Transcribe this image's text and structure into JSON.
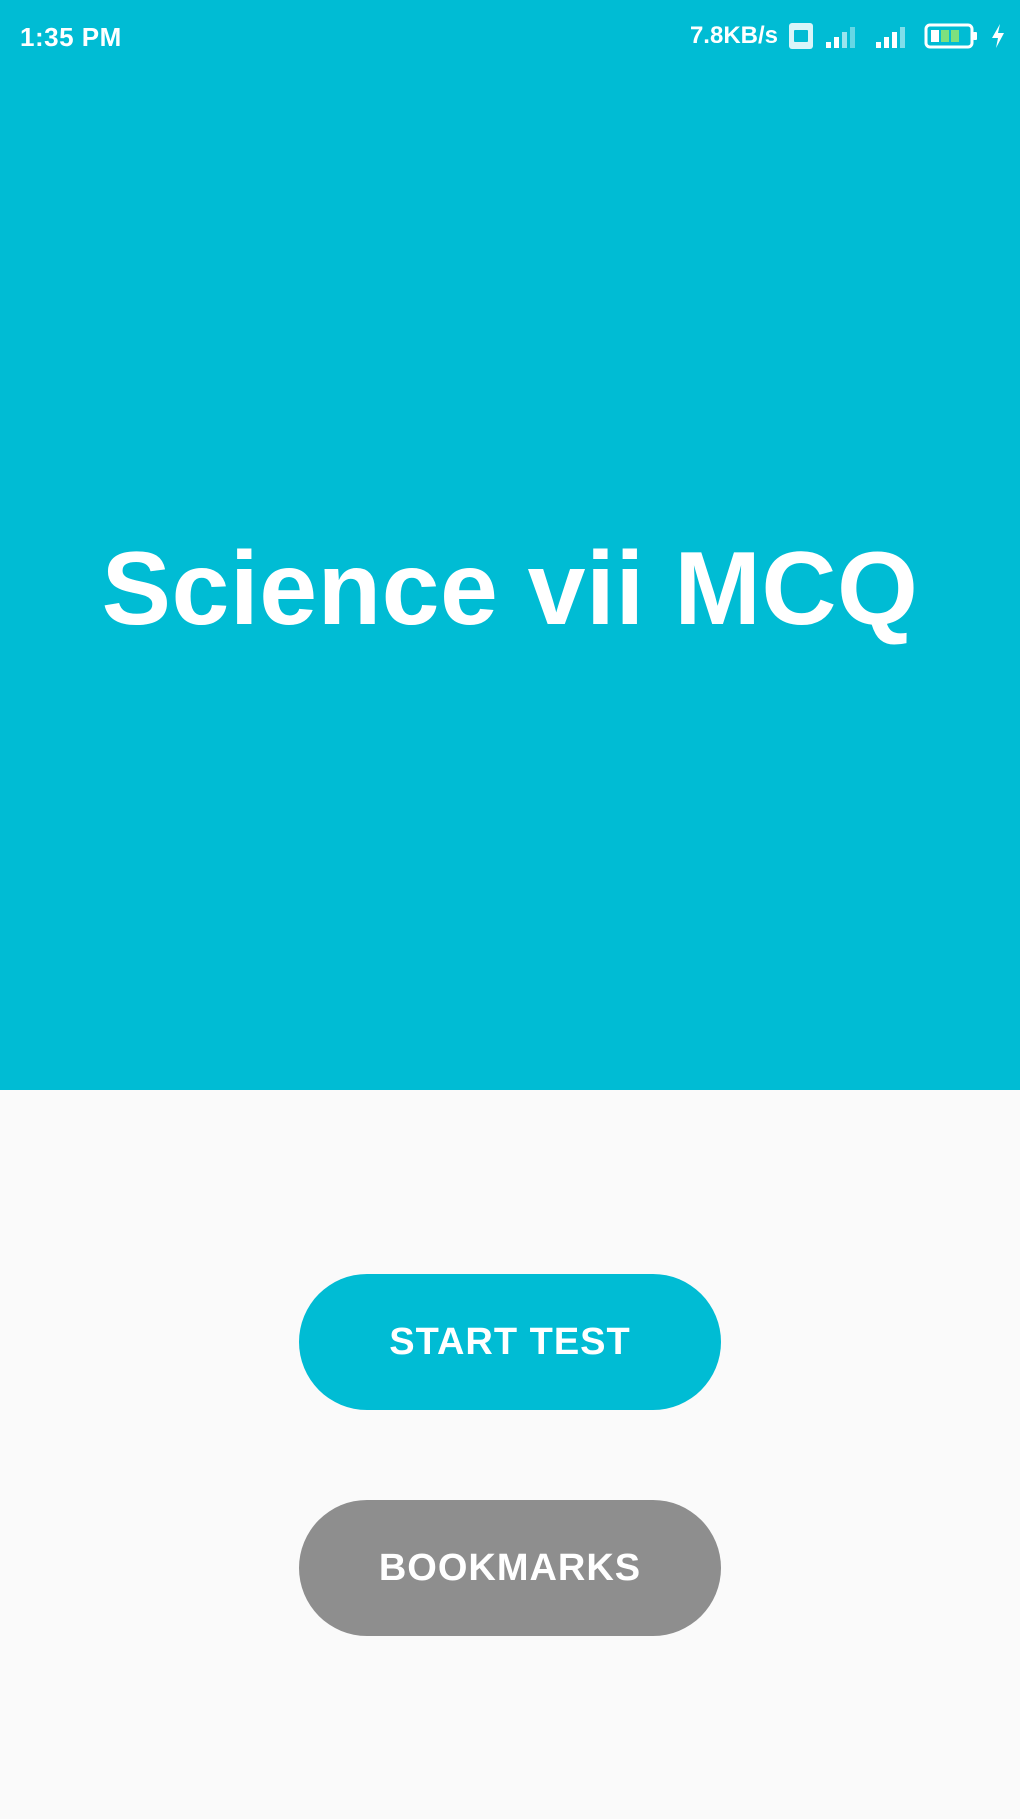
{
  "status_bar": {
    "time": "1:35 PM",
    "network_speed": "7.8KB/s",
    "icons": [
      "sim-card-icon",
      "wifi-signal-icon",
      "cell-signal-icon",
      "battery-icon",
      "charging-bolt-icon"
    ]
  },
  "header": {
    "title": "Science vii MCQ"
  },
  "buttons": {
    "start_test": "START TEST",
    "bookmarks": "BOOKMARKS"
  },
  "colors": {
    "primary": "#00bcd4",
    "secondary_button": "#8e8e8e",
    "background": "#fafafa",
    "text_on_primary": "#ffffff"
  }
}
